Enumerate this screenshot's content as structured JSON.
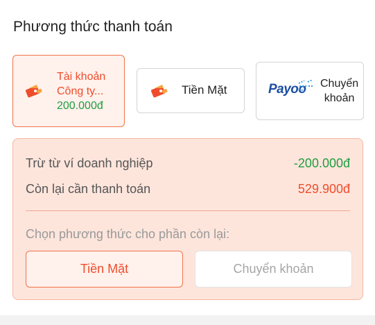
{
  "section_title": "Phương thức thanh toán",
  "methods": [
    {
      "name": "Tài khoản",
      "name2": "Công ty...",
      "balance": "200.000đ",
      "icon": "wallet-icon",
      "selected": true
    },
    {
      "name": "Tiền Mặt",
      "icon": "wallet-icon",
      "selected": false
    },
    {
      "logo_text": "Payoo",
      "name_line1": "Chuyển",
      "name_line2": "khoản",
      "icon": "payoo-logo",
      "selected": false
    }
  ],
  "summary": {
    "deduct_label": "Trừ từ ví doanh nghiệp",
    "deduct_value": "-200.000đ",
    "remaining_label": "Còn lại cần thanh toán",
    "remaining_value": "529.900đ",
    "choose_label": "Chọn phương thức cho phần còn lại:",
    "options": [
      {
        "label": "Tiền Mặt",
        "selected": true
      },
      {
        "label": "Chuyển khoản",
        "selected": false
      }
    ]
  },
  "colors": {
    "accent": "#ee4d2d",
    "green": "#1f9d3f",
    "panel_bg": "#fde5dc",
    "selected_bg": "#fff1ec"
  }
}
